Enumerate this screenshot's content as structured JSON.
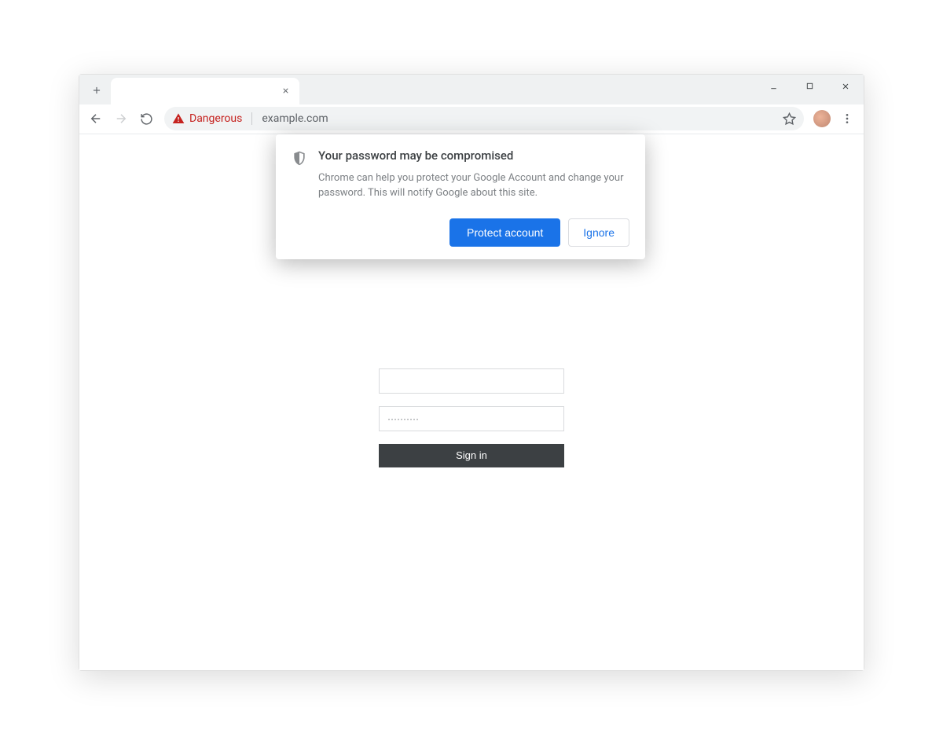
{
  "window": {
    "minimize_icon": "minimize",
    "maximize_icon": "maximize",
    "close_icon": "close"
  },
  "tab": {
    "close_icon": "close"
  },
  "toolbar": {
    "danger_label": "Dangerous",
    "url": "example.com"
  },
  "popup": {
    "title": "Your password may be compromised",
    "description": "Chrome can help you protect your Google Account and change your password. This will notify Google about this site.",
    "protect_label": "Protect account",
    "ignore_label": "Ignore"
  },
  "form": {
    "username_value": "",
    "password_value": "··········",
    "signin_label": "Sign in"
  }
}
